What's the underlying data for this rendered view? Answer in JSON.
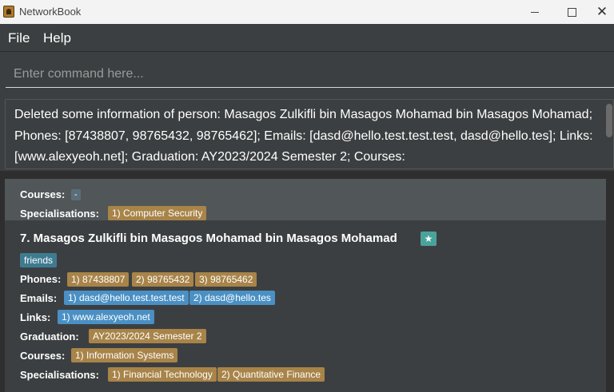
{
  "window": {
    "title": "NetworkBook",
    "close_glyph": "✕"
  },
  "menu": {
    "file": "File",
    "help": "Help"
  },
  "command": {
    "placeholder": "Enter command here..."
  },
  "result": {
    "text": "Deleted some information of person: Masagos Zulkifli bin Masagos Mohamad bin Masagos Mohamad; Phones: [87438807, 98765432, 98765462]; Emails: [dasd@hello.test.test.test, dasd@hello.tes]; Links: [www.alexyeoh.net]; Graduation: AY2023/2024 Semester 2; Courses:"
  },
  "previous_card": {
    "courses_label": "Courses:",
    "courses_value": "-",
    "specialisations_label": "Specialisations:",
    "specialisations": [
      "1) Computer Security"
    ]
  },
  "person": {
    "index_name": "7.  Masagos Zulkifli bin Masagos Mohamad bin Masagos Mohamad",
    "priority_icon": "star-icon",
    "priority_glyph": "★",
    "tag": "friends",
    "phones_label": "Phones:",
    "phones": [
      "1) 87438807",
      "2) 98765432",
      "3) 98765462"
    ],
    "emails_label": "Emails:",
    "emails": [
      "1) dasd@hello.test.test.test",
      "2) dasd@hello.tes"
    ],
    "links_label": "Links:",
    "links": [
      "1) www.alexyeoh.net"
    ],
    "graduation_label": "Graduation:",
    "graduation": "AY2023/2024 Semester 2",
    "courses_label": "Courses:",
    "courses": [
      "1) Information Systems"
    ],
    "specialisations_label": "Specialisations:",
    "specialisations": [
      "1) Financial Technology",
      "2) Quantitative Finance"
    ]
  },
  "colors": {
    "tag_brown": "#a88449",
    "tag_blue": "#3e7b91",
    "tag_email": "#4a90c4",
    "star": "#4aa39a"
  }
}
